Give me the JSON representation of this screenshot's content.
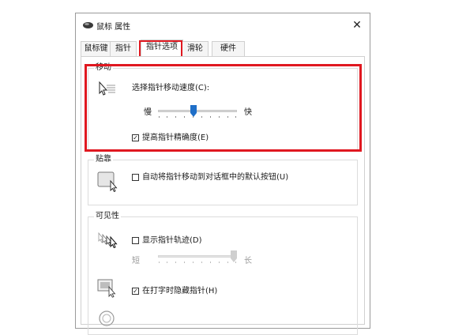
{
  "window": {
    "title": "鼠标 属性",
    "close": "✕"
  },
  "tabs": [
    {
      "label": "鼠标键"
    },
    {
      "label": "指针"
    },
    {
      "label": "指针选项",
      "active": true
    },
    {
      "label": "滑轮"
    },
    {
      "label": "硬件"
    }
  ],
  "motion": {
    "group_label": "移动",
    "speed_label": "选择指针移动速度(C):",
    "slow": "慢",
    "fast": "快",
    "speed_level": 0.45,
    "precision_label": "提高指针精确度(E)",
    "precision_checked": true
  },
  "snap": {
    "group_label": "贴靠",
    "snap_label": "自动将指针移动到对话框中的默认按钮(U)",
    "snap_checked": false
  },
  "visibility": {
    "group_label": "可见性",
    "trails_label": "显示指针轨迹(D)",
    "trails_checked": false,
    "short": "短",
    "long": "长",
    "trail_level": 1.0,
    "hide_label": "在打字时隐藏指针(H)",
    "hide_checked": true
  },
  "colors": {
    "highlight": "#e01820",
    "slider_thumb": "#1f6fc8"
  }
}
